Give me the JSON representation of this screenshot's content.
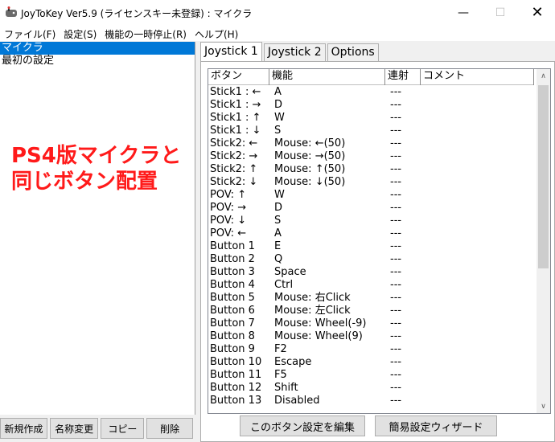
{
  "window": {
    "title": "JoyToKey Ver5.9 (ライセンスキー未登録) : マイクラ",
    "min_icon": "minimize-icon",
    "max_icon": "maximize-icon",
    "close_icon": "close-icon"
  },
  "menu": [
    "ファイル(F)",
    "設定(S)",
    "機能の一時停止(R)",
    "ヘルプ(H)"
  ],
  "configs": [
    {
      "label": "マイクラ",
      "selected": true
    },
    {
      "label": "最初の設定",
      "selected": false
    }
  ],
  "overlay": {
    "line1": "PS4版マイクラと",
    "line2": "同じボタン配置",
    "color": "#ff1a1a"
  },
  "left_buttons": [
    "新規作成",
    "名称変更",
    "コピー",
    "削除"
  ],
  "tabs": [
    {
      "label": "Joystick 1",
      "active": true
    },
    {
      "label": "Joystick 2",
      "active": false
    },
    {
      "label": "Options",
      "active": false
    }
  ],
  "columns": [
    "ボタン",
    "機能",
    "連射",
    "コメント"
  ],
  "rows": [
    {
      "button": "Stick1 : ←",
      "func": "A",
      "rapid": "---"
    },
    {
      "button": "Stick1 : →",
      "func": "D",
      "rapid": "---"
    },
    {
      "button": "Stick1 : ↑",
      "func": "W",
      "rapid": "---"
    },
    {
      "button": "Stick1 : ↓",
      "func": "S",
      "rapid": "---"
    },
    {
      "button": "Stick2: ←",
      "func": "Mouse: ←(50)",
      "rapid": "---"
    },
    {
      "button": "Stick2: →",
      "func": "Mouse: →(50)",
      "rapid": "---"
    },
    {
      "button": "Stick2: ↑",
      "func": "Mouse: ↑(50)",
      "rapid": "---"
    },
    {
      "button": "Stick2: ↓",
      "func": "Mouse: ↓(50)",
      "rapid": "---"
    },
    {
      "button": "POV: ↑",
      "func": "W",
      "rapid": "---"
    },
    {
      "button": "POV: →",
      "func": "D",
      "rapid": "---"
    },
    {
      "button": "POV: ↓",
      "func": "S",
      "rapid": "---"
    },
    {
      "button": "POV: ←",
      "func": "A",
      "rapid": "---"
    },
    {
      "button": "Button 1",
      "func": "E",
      "rapid": "---"
    },
    {
      "button": "Button 2",
      "func": "Q",
      "rapid": "---"
    },
    {
      "button": "Button 3",
      "func": "Space",
      "rapid": "---"
    },
    {
      "button": "Button 4",
      "func": "Ctrl",
      "rapid": "---"
    },
    {
      "button": "Button 5",
      "func": "Mouse: 右Click",
      "rapid": "---"
    },
    {
      "button": "Button 6",
      "func": "Mouse: 左Click",
      "rapid": "---"
    },
    {
      "button": "Button 7",
      "func": "Mouse: Wheel(-9)",
      "rapid": "---"
    },
    {
      "button": "Button 8",
      "func": "Mouse: Wheel(9)",
      "rapid": "---"
    },
    {
      "button": "Button 9",
      "func": "F2",
      "rapid": "---"
    },
    {
      "button": "Button 10",
      "func": "Escape",
      "rapid": "---"
    },
    {
      "button": "Button 11",
      "func": "F5",
      "rapid": "---"
    },
    {
      "button": "Button 12",
      "func": "Shift",
      "rapid": "---"
    },
    {
      "button": "Button 13",
      "func": "Disabled",
      "rapid": "---"
    }
  ],
  "panel_buttons": [
    "このボタン設定を編集",
    "簡易設定ウィザード"
  ],
  "colors": {
    "selection": "#0078d7",
    "scroll_thumb": "#cdcdcd"
  }
}
